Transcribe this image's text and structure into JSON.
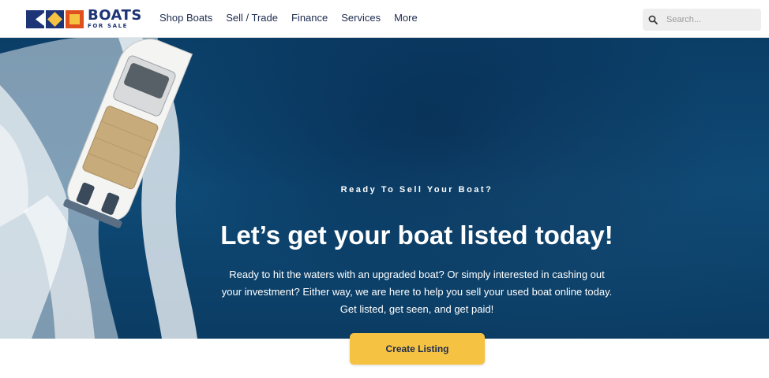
{
  "brand": {
    "name": "BOATS",
    "tagline": "FOR SALE",
    "colors": {
      "navy": "#1d3476",
      "yellow": "#f5c242",
      "orange": "#e0501f"
    }
  },
  "nav": {
    "items": [
      {
        "label": "Shop Boats"
      },
      {
        "label": "Sell / Trade"
      },
      {
        "label": "Finance"
      },
      {
        "label": "Services"
      },
      {
        "label": "More"
      }
    ]
  },
  "search": {
    "placeholder": "Search...",
    "value": "",
    "icon": "search-icon"
  },
  "hero": {
    "eyebrow": "Ready To Sell Your Boat?",
    "title": "Let’s get your boat listed today!",
    "body": "Ready to hit the waters with an upgraded boat? Or simply interested in cashing out your investment? Either way, we are here to help you sell your used boat online today. Get listed, get seen, and get paid!",
    "image": "aerial-speedboat-ocean"
  },
  "cta": {
    "label": "Create Listing",
    "color": "#f5c242"
  }
}
